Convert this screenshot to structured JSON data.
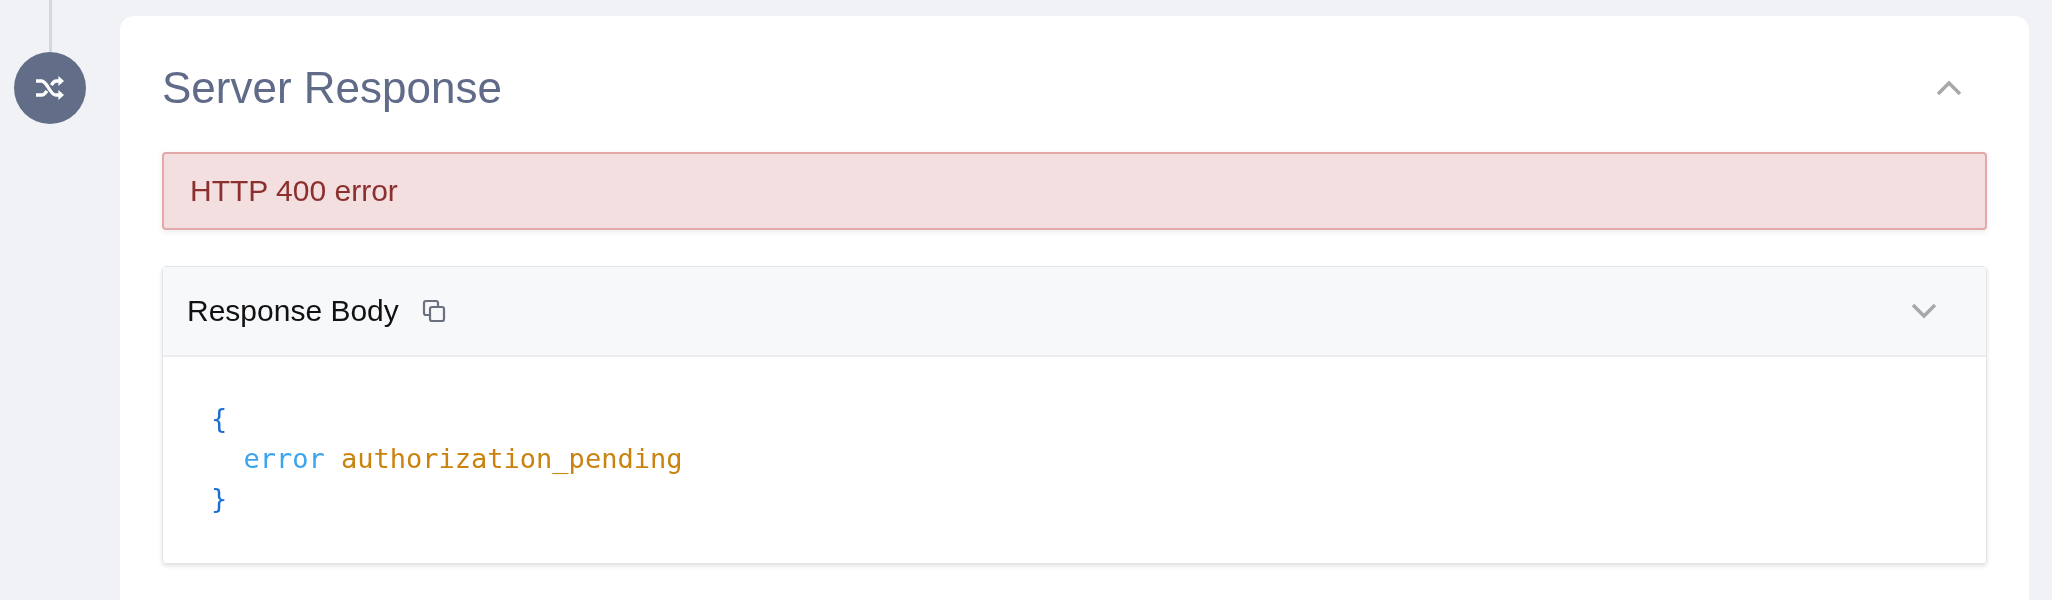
{
  "section": {
    "title": "Server Response",
    "expanded": true,
    "alert": {
      "text": "HTTP 400 error"
    },
    "response_body": {
      "title": "Response Body",
      "code": {
        "open": "{",
        "entries": [
          {
            "key": "error",
            "value": "authorization_pending"
          }
        ],
        "close": "}"
      }
    }
  }
}
